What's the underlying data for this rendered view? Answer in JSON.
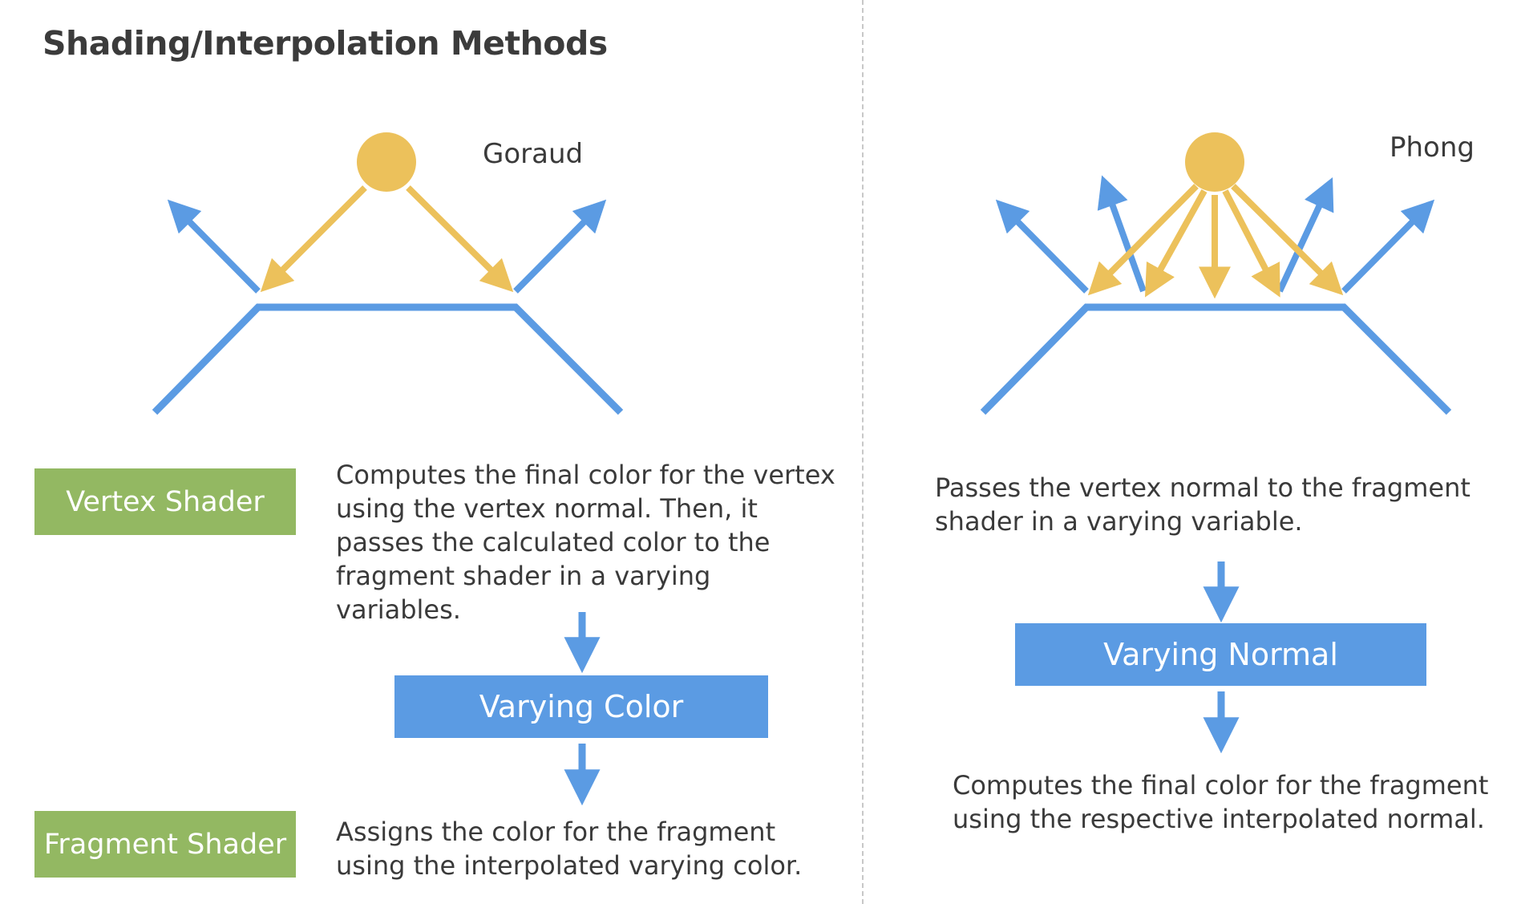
{
  "title": "Shading/Interpolation Methods",
  "colors": {
    "light": "#ecc15b",
    "normal": "#5b9be3",
    "stage_box": "#93b862",
    "varying_box": "#5b9be3",
    "text": "#3a3a3a"
  },
  "goraud": {
    "label": "Goraud",
    "vertex_shader_label": "Vertex Shader",
    "vertex_description": "Computes the final color for the vertex using the vertex normal. Then, it passes the calculated color to the fragment shader in a varying variables.",
    "varying_label": "Varying Color",
    "fragment_shader_label": "Fragment Shader",
    "fragment_description": "Assigns the color for the fragment using the interpolated varying color."
  },
  "phong": {
    "label": "Phong",
    "vertex_description": "Passes the vertex normal to the fragment shader in a varying variable.",
    "varying_label": "Varying Normal",
    "fragment_description": "Computes the final color for the fragment using the respective interpolated normal."
  }
}
